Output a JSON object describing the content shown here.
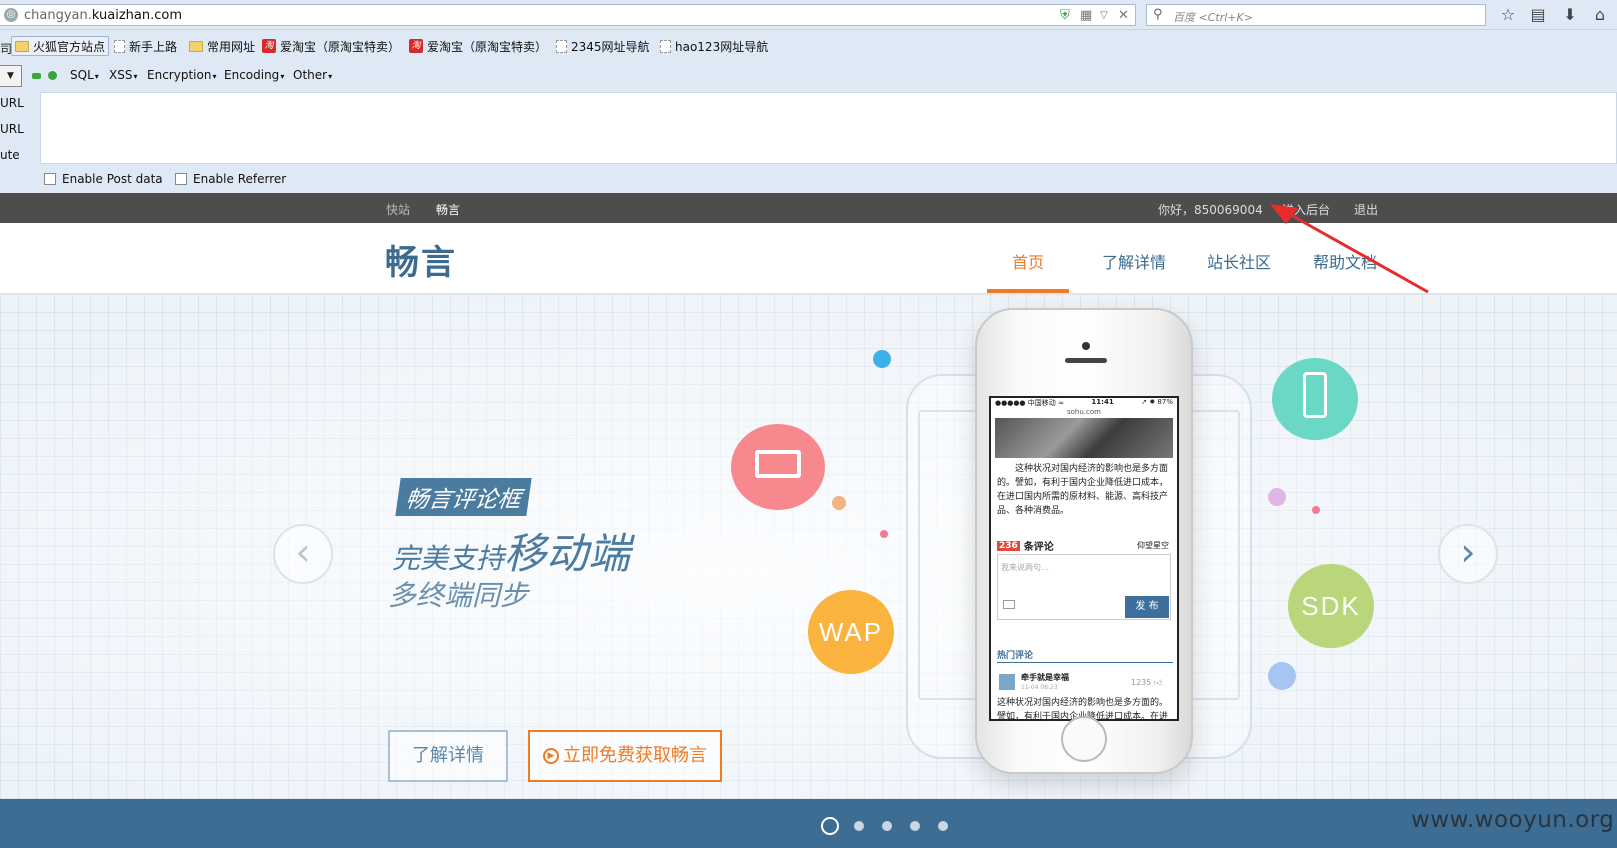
{
  "browser": {
    "url_prefix": "changyan.",
    "url_domain": "kuaizhan.com",
    "search_placeholder": "百度 <Ctrl+K>",
    "left_cut_char": "司",
    "bookmarks": [
      {
        "label": "火狐官方站点",
        "icon": "folder-icon"
      },
      {
        "label": "新手上路",
        "icon": "page-icon"
      },
      {
        "label": "常用网址",
        "icon": "folder-icon"
      },
      {
        "label": "爱淘宝（原淘宝特卖）",
        "icon": "taobao-icon"
      },
      {
        "label": "爱淘宝（原淘宝特卖）",
        "icon": "taobao-icon"
      },
      {
        "label": "2345网址导航",
        "icon": "page-icon"
      },
      {
        "label": "hao123网址导航",
        "icon": "page-icon"
      }
    ]
  },
  "hackbar": {
    "menus": [
      "SQL",
      "XSS",
      "Encryption",
      "Encoding",
      "Other"
    ],
    "side_labels": [
      "URL",
      "URL",
      "ute"
    ],
    "checkboxes": [
      "Enable Post data",
      "Enable Referrer"
    ]
  },
  "site": {
    "top_left_links": [
      "快站",
      "畅言"
    ],
    "greeting": "你好，850069004",
    "admin_link": "进入后台",
    "logout_link": "退出",
    "logo": "畅言",
    "nav": [
      "首页",
      "了解详情",
      "站长社区",
      "帮助文档"
    ],
    "nav_active": "首页",
    "accent_color": "#f07b23",
    "brand_color": "#3b6b8f"
  },
  "hero": {
    "tag": "畅言评论框",
    "line1_prefix": "完美支持",
    "line1_big": "移动端",
    "line2": "多终端同步",
    "btn_learn": "了解详情",
    "btn_free": "立即免费获取畅言",
    "bubble_wap": "WAP",
    "bubble_sdk": "SDK",
    "slide_count": 5,
    "active_slide": 1
  },
  "phone": {
    "carrier": "●●●●● 中国移动 ≈",
    "time": "11:41",
    "battery": "➚ ✹ 87%",
    "site": "sohu.com",
    "body": "这种状况对国内经济的影响也是多方面的。譬如，有利于国内企业降低进口成本，在进口国内所需的原材料、能源、高科技产品、各种消费品。",
    "count": "236",
    "count_label": "条评论",
    "user": "仰望星空",
    "placeholder": "我来说两句…",
    "send": "发 布",
    "hot_title": "热门评论",
    "hot_user": "牵手就是幸福",
    "hot_date": "11-04  08:23",
    "hot_likes": "1235",
    "hot_body": "这种状况对国内经济的影响也是多方面的。譬如，有利于国内企业降低进口成本。在进口国"
  },
  "watermark": "www.wooyun.org"
}
